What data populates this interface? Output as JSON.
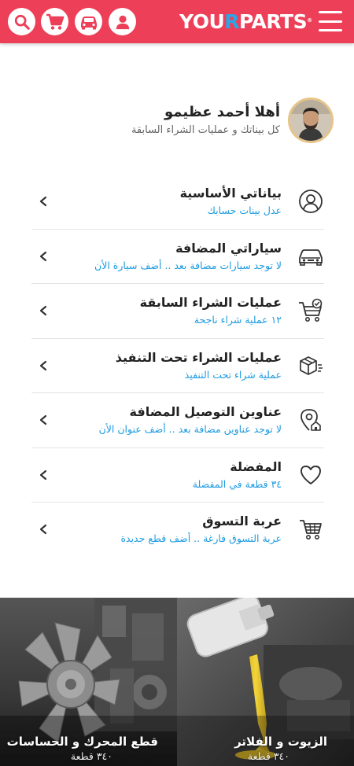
{
  "header": {
    "logo_part1": "YOU",
    "logo_part2": "R",
    "logo_part3": "PARTS",
    "logo_mark": "®",
    "brand_color": "#ee3f58",
    "accent_color": "#2aa7e8",
    "icons": [
      "search-icon",
      "cart-icon",
      "car-icon",
      "user-icon",
      "menu-icon"
    ]
  },
  "profile": {
    "greeting": "أهلا أحمد عظيمو",
    "subtitle": "كل بيناتك و عمليات الشراء السابقة"
  },
  "menu": [
    {
      "title": "بياناتي الأساسية",
      "subtitle": "عدل بينات حسابك",
      "icon": "user-circle-icon"
    },
    {
      "title": "سياراتي المضافة",
      "subtitle": "لا توجد سيارات مضافة بعد .. أضف سيارة الأن",
      "icon": "car-icon"
    },
    {
      "title": "عمليات الشراء السابقة",
      "subtitle": "١٢ عملية شراء ناجحة",
      "icon": "cart-check-icon"
    },
    {
      "title": "عمليات الشراء تحت التنفيذ",
      "subtitle": "عملية شراء تحت التنفيذ",
      "icon": "delivery-box-icon"
    },
    {
      "title": "عناوين التوصيل المضافة",
      "subtitle": "لا توجد عناوين مضافة بعد .. أضف عنوان الأن",
      "icon": "location-home-icon"
    },
    {
      "title": "المفضلة",
      "subtitle": "٣٤ قطعة في المفضلة",
      "icon": "heart-icon"
    },
    {
      "title": "عربة التسوق",
      "subtitle": "عربة التسوق فارغة .. أضف قطع جديدة",
      "icon": "shopping-cart-icon"
    }
  ],
  "categories": [
    {
      "title": "قطع المحرك و الحساسات",
      "count": "٣٤٠ قطعة"
    },
    {
      "title": "الزيوت و الفلاتر",
      "count": "٣٤٠ قطعة"
    }
  ]
}
